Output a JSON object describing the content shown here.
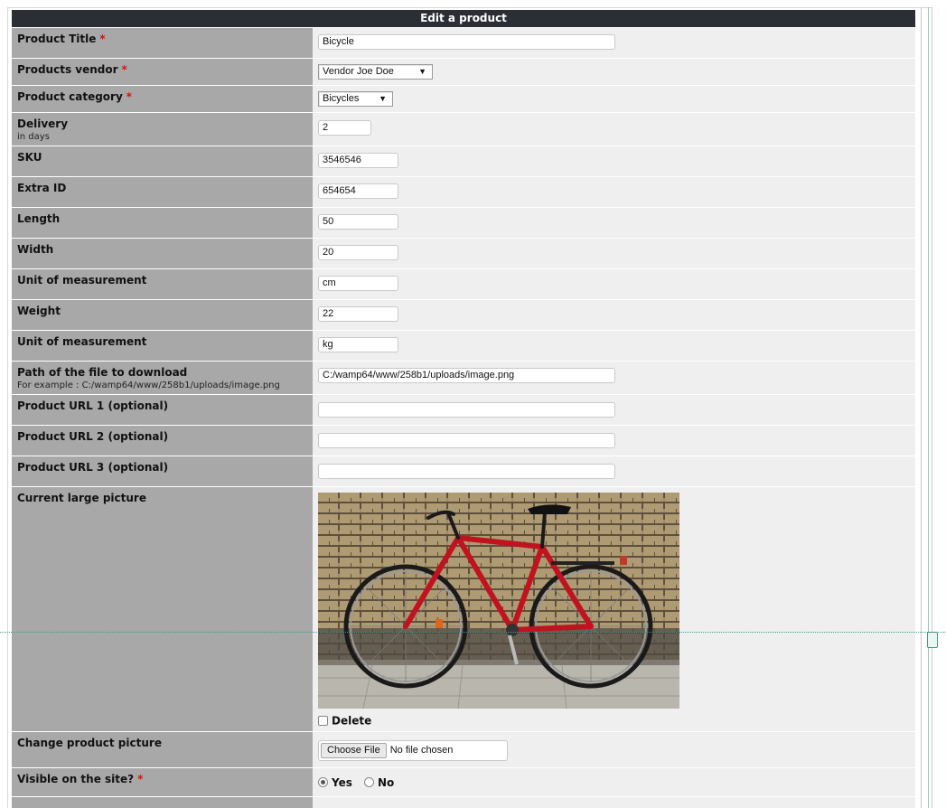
{
  "form": {
    "title": "Edit a product",
    "required_mark": "*",
    "fields": {
      "title": {
        "label": "Product Title",
        "value": "Bicycle"
      },
      "vendor": {
        "label": "Products vendor",
        "value": "Vendor Joe Doe"
      },
      "category": {
        "label": "Product category",
        "value": "Bicycles"
      },
      "delivery": {
        "label": "Delivery",
        "hint": "in days",
        "value": "2"
      },
      "sku": {
        "label": "SKU",
        "value": "3546546"
      },
      "extra_id": {
        "label": "Extra ID",
        "value": "654654"
      },
      "length": {
        "label": "Length",
        "value": "50"
      },
      "width": {
        "label": "Width",
        "value": "20"
      },
      "unit1": {
        "label": "Unit of measurement",
        "value": "cm"
      },
      "weight": {
        "label": "Weight",
        "value": "22"
      },
      "unit2": {
        "label": "Unit of measurement",
        "value": "kg"
      },
      "path": {
        "label": "Path of the file to download",
        "hint": "For example : C:/wamp64/www/258b1/uploads/image.png",
        "value": "C:/wamp64/www/258b1/uploads/image.png"
      },
      "url1": {
        "label": "Product URL 1 (optional)",
        "value": ""
      },
      "url2": {
        "label": "Product URL 2 (optional)",
        "value": ""
      },
      "url3": {
        "label": "Product URL 3 (optional)",
        "value": ""
      },
      "picture": {
        "label": "Current large picture",
        "delete_label": "Delete"
      },
      "change_picture": {
        "label": "Change product picture",
        "button": "Choose File",
        "status": "No file chosen"
      },
      "visible": {
        "label": "Visible on the site?",
        "yes": "Yes",
        "no": "No",
        "selected": "Yes"
      }
    }
  },
  "colors": {
    "header_bg": "#2b2f35",
    "label_bg": "#a8a8a8",
    "value_bg": "#efefef",
    "required": "#dd1111"
  }
}
